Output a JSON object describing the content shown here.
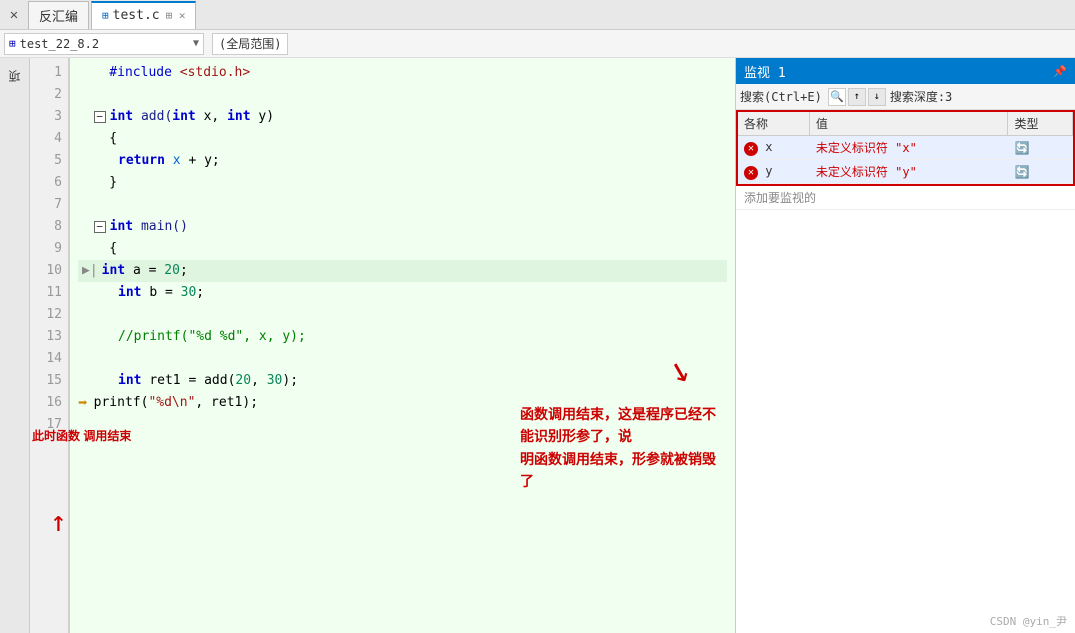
{
  "tabs": {
    "close_btn": "✕",
    "items": [
      {
        "label": "反汇编",
        "active": false,
        "closable": false
      },
      {
        "label": "test.c",
        "active": true,
        "closable": true,
        "pin_icon": "⊞"
      }
    ]
  },
  "toolbar": {
    "func_name": "test_22_8.2",
    "func_icon": "⊞",
    "scope": "(全局范围)",
    "dropdown_arrow": "▼"
  },
  "editor": {
    "lines": [
      {
        "num": 1,
        "code": "    #include <stdio.h>",
        "type": "normal"
      },
      {
        "num": 2,
        "code": "",
        "type": "normal"
      },
      {
        "num": 3,
        "code": "  ⊟ int add(int x, int y)",
        "type": "normal"
      },
      {
        "num": 4,
        "code": "    {",
        "type": "normal"
      },
      {
        "num": 5,
        "code": "        return x + y;",
        "type": "normal"
      },
      {
        "num": 6,
        "code": "    }",
        "type": "normal"
      },
      {
        "num": 7,
        "code": "",
        "type": "normal"
      },
      {
        "num": 8,
        "code": "  ⊟ int main()",
        "type": "normal"
      },
      {
        "num": 9,
        "code": "    {",
        "type": "normal"
      },
      {
        "num": 10,
        "code": "    ▶|  int a = 20;",
        "type": "exec"
      },
      {
        "num": 11,
        "code": "        int b = 30;",
        "type": "normal"
      },
      {
        "num": 12,
        "code": "",
        "type": "normal"
      },
      {
        "num": 13,
        "code": "        //printf(\"%d %d\", x, y);",
        "type": "comment"
      },
      {
        "num": 14,
        "code": "",
        "type": "normal"
      },
      {
        "num": 15,
        "code": "        int ret1 = add(20, 30);",
        "type": "normal"
      },
      {
        "num": 16,
        "code": "    ➡   printf(\"%d\\n\", ret1);",
        "type": "arrow"
      },
      {
        "num": 17,
        "code": "",
        "type": "normal"
      }
    ]
  },
  "watch": {
    "title": "监视 1",
    "pin_icon": "📌",
    "search_label": "搜索(Ctrl+E)",
    "search_placeholder": "",
    "depth_label": "搜索深度:",
    "depth_value": "3",
    "columns": [
      "各称",
      "值",
      "类型"
    ],
    "rows": [
      {
        "name": "x",
        "value": "未定义标识符 \"x\"",
        "type": "",
        "error": true
      },
      {
        "name": "y",
        "value": "未定义标识符 \"y\"",
        "type": "",
        "error": true
      }
    ],
    "add_row_label": "添加要监视的"
  },
  "annotations": {
    "left_text": "此时函数\n调用结束",
    "right_text": "函数调用结束，这是程序已经不能识别形参了，说\n明函数调用结束，形参就被销毁了"
  },
  "watermark": "CSDN @yin_尹"
}
